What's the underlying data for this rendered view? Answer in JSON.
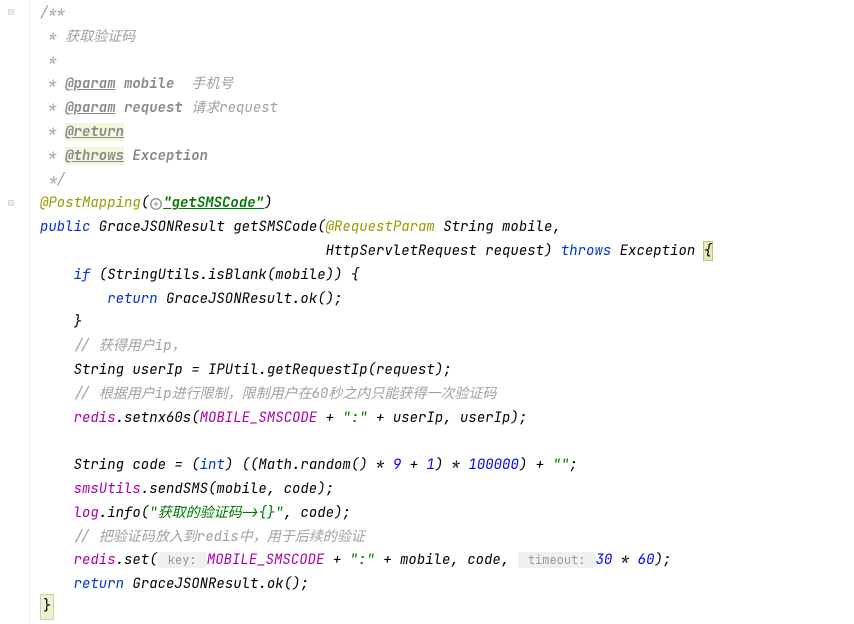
{
  "javadoc": {
    "open": "/**",
    "line1": " * 获取验证码",
    "line2": " *",
    "line3_prefix": " * ",
    "line3_tag": "@param",
    "line3_param": " mobile  ",
    "line3_desc": "手机号",
    "line4_prefix": " * ",
    "line4_tag": "@param",
    "line4_param": " request ",
    "line4_desc": "请求request",
    "line5_prefix": " * ",
    "line5_tag": "@return",
    "line6_prefix": " * ",
    "line6_tag": "@throws",
    "line6_rest": " Exception",
    "close": " */"
  },
  "annotation": {
    "name": "@PostMapping",
    "open_paren": "(",
    "value": "\"getSMSCode\"",
    "close_paren": ")"
  },
  "method": {
    "modifier": "public",
    "return_type": " GraceJSONResult ",
    "name": "getSMSCode",
    "param1_ann": "@RequestParam",
    "param1_type": " String ",
    "param1_name": "mobile",
    "param2_type": "HttpServletRequest ",
    "param2_name": "request",
    "throws": "throws",
    "exception": " Exception ",
    "brace": "{"
  },
  "body": {
    "if_kw": "if",
    "if_cond_open": " (StringUtils.",
    "isBlank": "isBlank",
    "if_cond_close": "(mobile)) {",
    "return_kw": "return",
    "grace_ok": " GraceJSONResult.",
    "ok_method": "ok",
    "ok_close": "();",
    "close_brace": "}",
    "comment1": "// 获得用户ip，",
    "userIp_decl": "String userIp = IPUtil.",
    "getRequestIp": "getRequestIp",
    "getRequestIp_args": "(request);",
    "comment2": "// 根据用户ip进行限制，限制用户在60秒之内只能获得一次验证码",
    "redis_field": "redis",
    "setnx60s": ".setnx60s(",
    "mobile_smscode": "MOBILE_SMSCODE",
    "plus_colon": " + ",
    "colon_str": "\":\"",
    "plus_userIp": " + userIp, userIp);",
    "code_decl": "String code = (",
    "int_kw": "int",
    "math_random": ") ((Math.",
    "random_method": "random",
    "random_calc1": "() * ",
    "nine": "9",
    "plus": " + ",
    "one": "1",
    "times": ") * ",
    "hundred_thousand": "100000",
    "code_end": ") + ",
    "empty_str": "\"\"",
    "semicolon": ";",
    "smsUtils": "smsUtils",
    "sendSMS": ".sendSMS(mobile, code);",
    "log": "log",
    "info_method": ".info(",
    "info_str": "\"获取的验证码->{}\"",
    "info_end": ", code);",
    "comment3": "// 把验证码放入到redis中，用于后续的验证",
    "redis_set": ".set(",
    "key_hint": " key: ",
    "plus_mobile": " + mobile, code, ",
    "timeout_hint": " timeout: ",
    "thirty": "30",
    "times_60": " * ",
    "sixty": "60",
    "set_close": ");",
    "final_return": " GraceJSONResult.",
    "final_ok": "ok",
    "final_close": "();"
  },
  "bottom_marker": "}"
}
